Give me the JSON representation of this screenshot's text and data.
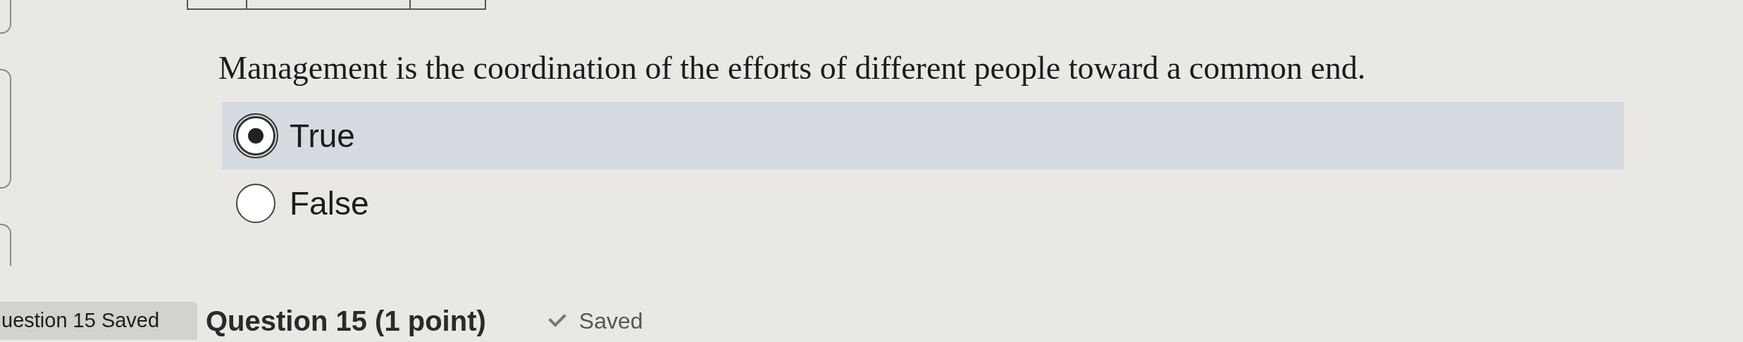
{
  "question": {
    "text": "Management is the coordination of the efforts of different people toward a common end.",
    "options": [
      {
        "label": "True",
        "selected": true
      },
      {
        "label": "False",
        "selected": false
      }
    ]
  },
  "status_tab": "uestion 15 Saved",
  "next_question": {
    "title": "Question 15 (1 point)",
    "status": "Saved"
  }
}
